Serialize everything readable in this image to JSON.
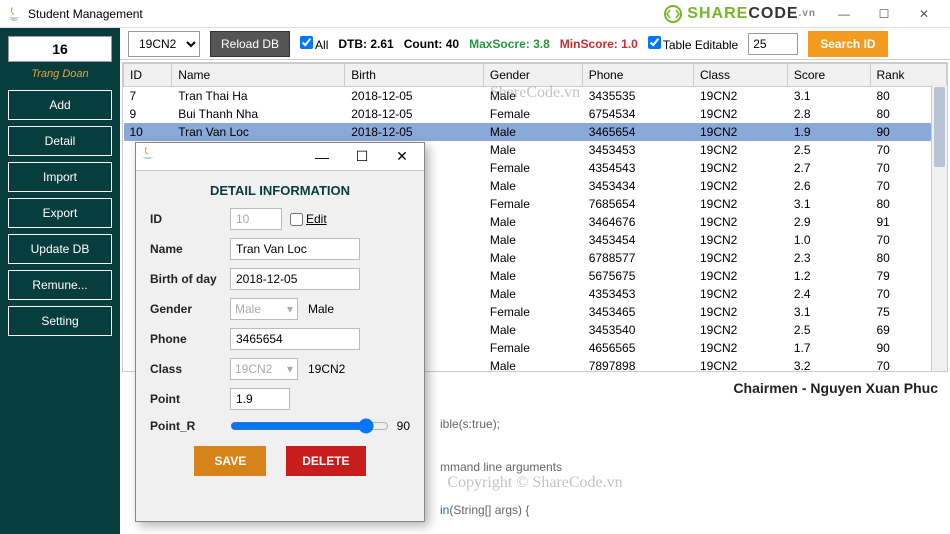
{
  "window": {
    "title": "Student Management"
  },
  "logo": {
    "share": "SHARE",
    "code": "CODE",
    "vn": ".vn"
  },
  "sidebar": {
    "counter": "16",
    "username": "Trang Doan",
    "buttons": [
      "Add",
      "Detail",
      "Import",
      "Export",
      "Update DB",
      "Remune...",
      "Setting"
    ]
  },
  "toolbar": {
    "class_select": "19CN2",
    "reload": "Reload DB",
    "all_label": "All",
    "dtb": "DTB: 2.61",
    "count": "Count: 40",
    "maxscore": "MaxSocre: 3.8",
    "minscore": "MinScore: 1.0",
    "editable_label": "Table Editable",
    "search_value": "25",
    "search_btn": "Search ID"
  },
  "table": {
    "headers": [
      "ID",
      "Name",
      "Birth",
      "Gender",
      "Phone",
      "Class",
      "Score",
      "Rank"
    ],
    "rows": [
      {
        "id": "7",
        "name": "Tran Thai Ha",
        "birth": "2018-12-05",
        "gender": "Male",
        "phone": "3435535",
        "class": "19CN2",
        "score": "3.1",
        "rank": "80"
      },
      {
        "id": "9",
        "name": "Bui Thanh Nha",
        "birth": "2018-12-05",
        "gender": "Female",
        "phone": "6754534",
        "class": "19CN2",
        "score": "2.8",
        "rank": "80"
      },
      {
        "id": "10",
        "name": "Tran Van Loc",
        "birth": "2018-12-05",
        "gender": "Male",
        "phone": "3465654",
        "class": "19CN2",
        "score": "1.9",
        "rank": "90",
        "sel": true
      },
      {
        "id": "",
        "name": "",
        "birth": "",
        "gender": "Male",
        "phone": "3453453",
        "class": "19CN2",
        "score": "2.5",
        "rank": "70"
      },
      {
        "id": "",
        "name": "",
        "birth": "",
        "gender": "Female",
        "phone": "4354543",
        "class": "19CN2",
        "score": "2.7",
        "rank": "70"
      },
      {
        "id": "",
        "name": "",
        "birth": "",
        "gender": "Male",
        "phone": "3453434",
        "class": "19CN2",
        "score": "2.6",
        "rank": "70"
      },
      {
        "id": "",
        "name": "",
        "birth": "",
        "gender": "Female",
        "phone": "7685654",
        "class": "19CN2",
        "score": "3.1",
        "rank": "80"
      },
      {
        "id": "",
        "name": "",
        "birth": "",
        "gender": "Male",
        "phone": "3464676",
        "class": "19CN2",
        "score": "2.9",
        "rank": "91"
      },
      {
        "id": "",
        "name": "",
        "birth": "",
        "gender": "Male",
        "phone": "3453454",
        "class": "19CN2",
        "score": "1.0",
        "rank": "70"
      },
      {
        "id": "",
        "name": "",
        "birth": "",
        "gender": "Male",
        "phone": "6788577",
        "class": "19CN2",
        "score": "2.3",
        "rank": "80"
      },
      {
        "id": "",
        "name": "",
        "birth": "",
        "gender": "Male",
        "phone": "5675675",
        "class": "19CN2",
        "score": "1.2",
        "rank": "79"
      },
      {
        "id": "",
        "name": "",
        "birth": "",
        "gender": "Male",
        "phone": "4353453",
        "class": "19CN2",
        "score": "2.4",
        "rank": "70"
      },
      {
        "id": "",
        "name": "",
        "birth": "",
        "gender": "Female",
        "phone": "3453465",
        "class": "19CN2",
        "score": "3.1",
        "rank": "75"
      },
      {
        "id": "",
        "name": "",
        "birth": "",
        "gender": "Male",
        "phone": "3453540",
        "class": "19CN2",
        "score": "2.5",
        "rank": "69"
      },
      {
        "id": "",
        "name": "",
        "birth": "",
        "gender": "Female",
        "phone": "4656565",
        "class": "19CN2",
        "score": "1.7",
        "rank": "90"
      },
      {
        "id": "",
        "name": "",
        "birth": "",
        "gender": "Male",
        "phone": "7897898",
        "class": "19CN2",
        "score": "3.2",
        "rank": "70"
      }
    ]
  },
  "chairmen": "Chairmen - Nguyen Xuan Phuc",
  "watermark": "ShareCode.vn",
  "watermark2": "Copyright © ShareCode.vn",
  "code": {
    "l1": "ible(s:true);",
    "l2": "mmand line arguments",
    "l3a": "in",
    "l3b": "(String[] args) {"
  },
  "dialog": {
    "title": "DETAIL INFORMATION",
    "labels": {
      "id": "ID",
      "name": "Name",
      "birth": "Birth of day",
      "gender": "Gender",
      "phone": "Phone",
      "class": "Class",
      "point": "Point",
      "pointr": "Point_R",
      "edit": "Edit"
    },
    "values": {
      "id": "10",
      "name": "Tran Van Loc",
      "birth": "2018-12-05",
      "gender_combo": "Male",
      "gender": "Male",
      "phone": "3465654",
      "class_combo": "19CN2",
      "class": "19CN2",
      "point": "1.9",
      "pointr": "90"
    },
    "buttons": {
      "save": "SAVE",
      "delete": "DELETE"
    }
  }
}
